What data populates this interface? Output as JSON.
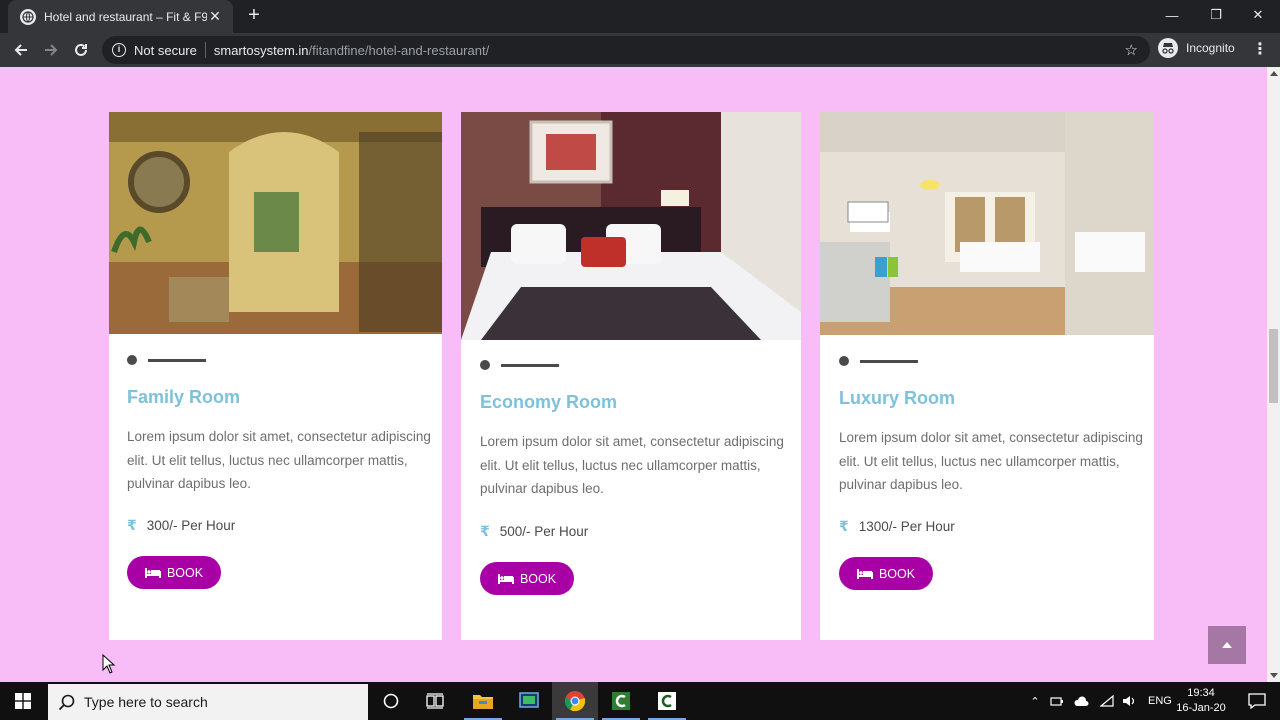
{
  "browser": {
    "tab_title": "Hotel and restaurant – Fit & F9",
    "tab_close": "✕",
    "new_tab": "+",
    "security_label": "Not secure",
    "url_host": "smartosystem.in",
    "url_path": "/fitandfine/hotel-and-restaurant/",
    "incognito_label": "Incognito",
    "window_controls": {
      "minimize": "—",
      "maximize": "❐",
      "close": "✕"
    }
  },
  "rooms": [
    {
      "title": "Family Room",
      "description": "Lorem ipsum dolor sit amet, consectetur adipiscing elit. Ut elit tellus, luctus nec ullamcorper mattis, pulvinar dapibus leo.",
      "currency": "₹",
      "price": "300/- Per Hour",
      "button": "BOOK"
    },
    {
      "title": "Economy Room",
      "description": "Lorem ipsum dolor sit amet, consectetur adipiscing elit. Ut elit tellus, luctus nec ullamcorper mattis, pulvinar dapibus leo.",
      "currency": "₹",
      "price": "500/- Per Hour",
      "button": "BOOK"
    },
    {
      "title": "Luxury Room",
      "description": "Lorem ipsum dolor sit amet, consectetur adipiscing elit. Ut elit tellus, luctus nec ullamcorper mattis, pulvinar dapibus leo.",
      "currency": "₹",
      "price": "1300/- Per Hour",
      "button": "BOOK"
    }
  ],
  "taskbar": {
    "search_placeholder": "Type here to search",
    "language": "ENG",
    "time": "19:34",
    "date": "16-Jan-20"
  },
  "colors": {
    "page_background": "#f8bdf7",
    "title_accent": "#7ec1db",
    "book_button": "#a800a6",
    "back_to_top": "#a577a5"
  },
  "icons": [
    "globe-icon",
    "back-arrow-icon",
    "forward-arrow-icon",
    "reload-icon",
    "info-icon",
    "star-icon",
    "incognito-icon",
    "menu-dots-icon",
    "rupee-icon",
    "bed-icon",
    "caret-up-icon",
    "windows-icon",
    "search-icon",
    "cortana-icon",
    "task-view-icon",
    "file-explorer-icon",
    "chrome-icon",
    "camtasia-icon"
  ]
}
